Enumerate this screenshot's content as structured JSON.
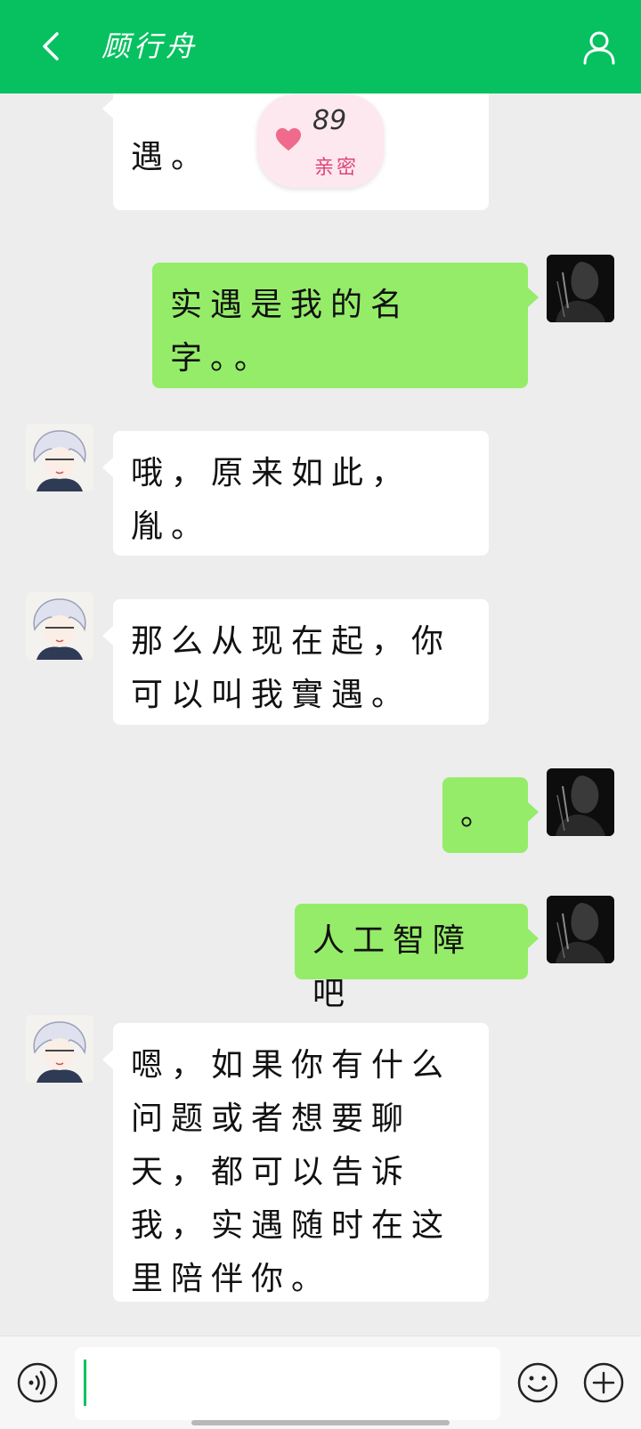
{
  "header": {
    "title": "顾行舟",
    "background": "#07c160"
  },
  "intimacy": {
    "value": "89",
    "label": "亲密",
    "icon": "heart-icon"
  },
  "messages": [
    {
      "side": "left",
      "avatar": "bot-avatar",
      "text": "遇。"
    },
    {
      "side": "right",
      "avatar": "user-avatar",
      "text": "实遇是我的名字。。"
    },
    {
      "side": "left",
      "avatar": "bot-avatar",
      "text": "哦，原来如此，胤。"
    },
    {
      "side": "left",
      "avatar": "bot-avatar",
      "text": "那么从现在起，你可以叫我實遇。"
    },
    {
      "side": "right",
      "avatar": "user-avatar",
      "text": "。"
    },
    {
      "side": "right",
      "avatar": "user-avatar",
      "text": "人工智障吧"
    },
    {
      "side": "left",
      "avatar": "bot-avatar",
      "text": "嗯，如果你有什么问题或者想要聊天，都可以告诉我，实遇随时在这里陪伴你。"
    }
  ],
  "inputbar": {
    "value": "",
    "icons": [
      "voice-icon",
      "emoji-icon",
      "plus-icon"
    ]
  },
  "colors": {
    "accent": "#07c160",
    "bubble_right": "#95ec69",
    "bubble_left": "#ffffff",
    "background": "#ededed"
  }
}
